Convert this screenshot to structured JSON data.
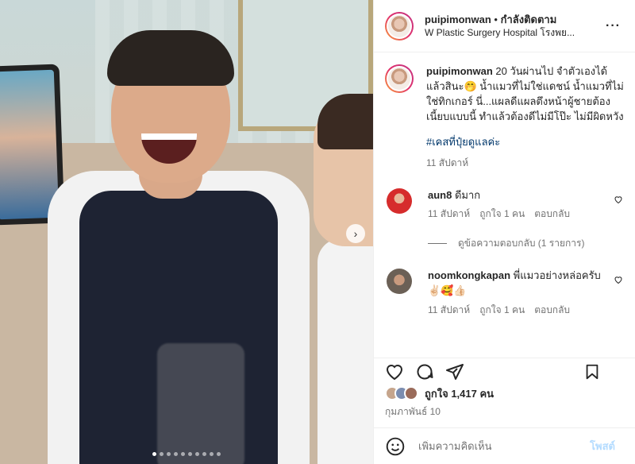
{
  "post": {
    "username": "puipimonwan",
    "separator": "•",
    "follow_status": "กำลังติดตาม",
    "location": "W Plastic Surgery Hospital โรงพย...",
    "more_icon": "more-horizontal-icon"
  },
  "caption": {
    "username": "puipimonwan",
    "text": "20 วันผ่านไป จำตัวเองได้แล้วสินะ🤭 น้ำแมวที่ไม่ใช่แดชน์ น้ำแมวที่ไม่ใช่ทิกเกอร์ นี่...แผลดีแผลตึงหน้าผู้ชายต้องเนี้ยบแบบนี้ ทำแล้วต้องดีไม่มีโป๊ะ ไม่มีผิดหวัง",
    "hashtag": "#เคสที่ปุ๋ยดูแลค่ะ",
    "time": "11 สัปดาห์"
  },
  "comments": [
    {
      "username": "aun8",
      "text": "ดีมาก",
      "time": "11 สัปดาห์",
      "likes": "ถูกใจ 1 คน",
      "reply": "ตอบกลับ",
      "avatar_color": "#d62c2c"
    },
    {
      "username": "noomkongkapan",
      "text": "พี่แมวอย่างหล่อครับ ✌🏻🥰👍🏻",
      "time": "11 สัปดาห์",
      "likes": "ถูกใจ 1 คน",
      "reply": "ตอบกลับ",
      "avatar_color": "#6b6056"
    }
  ],
  "view_replies": "ดูข้อความตอบกลับ (1 รายการ)",
  "actions": {
    "like_icon": "heart-icon",
    "comment_icon": "comment-icon",
    "share_icon": "share-icon",
    "save_icon": "bookmark-icon",
    "likes_label": "ถูกใจ 1,417 คน",
    "date": "กุมภาพันธ์ 10"
  },
  "add_comment": {
    "placeholder": "เพิ่มความคิดเห็น",
    "post_label": "โพสต์"
  },
  "carousel": {
    "slide_count": 10,
    "active_index": 0,
    "next_icon": "chevron-right-icon"
  },
  "colors": {
    "link": "#00376b",
    "muted": "#737373",
    "post_button": "#b3dbff",
    "avatar_ring": [
      "#f9a13a",
      "#e1306c",
      "#c13584"
    ]
  }
}
